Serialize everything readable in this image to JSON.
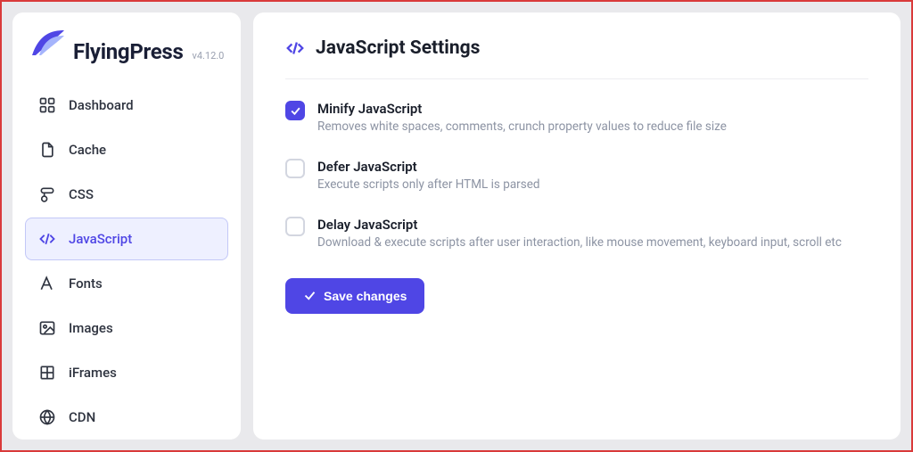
{
  "brand": {
    "name": "FlyingPress",
    "version": "v4.12.0"
  },
  "sidebar": {
    "items": [
      {
        "label": "Dashboard"
      },
      {
        "label": "Cache"
      },
      {
        "label": "CSS"
      },
      {
        "label": "JavaScript"
      },
      {
        "label": "Fonts"
      },
      {
        "label": "Images"
      },
      {
        "label": "iFrames"
      },
      {
        "label": "CDN"
      }
    ]
  },
  "page": {
    "title": "JavaScript Settings"
  },
  "options": [
    {
      "title": "Minify JavaScript",
      "description": "Removes white spaces, comments, crunch property values to reduce file size",
      "checked": true
    },
    {
      "title": "Defer JavaScript",
      "description": "Execute scripts only after HTML is parsed",
      "checked": false
    },
    {
      "title": "Delay JavaScript",
      "description": "Download & execute scripts after user interaction, like mouse movement, keyboard input, scroll etc",
      "checked": false
    }
  ],
  "buttons": {
    "save": "Save changes"
  }
}
